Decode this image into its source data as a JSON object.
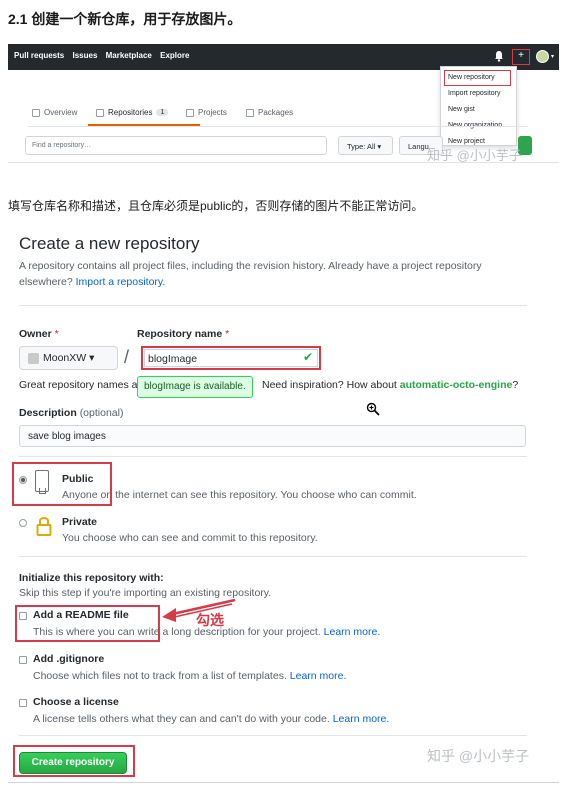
{
  "section_title": "2.1 创建一个新仓库，用于存放图片。",
  "instruction": "填写仓库名称和描述，且仓库必须是public的，否则存储的图片不能正常访问。",
  "header": {
    "nav": [
      "Pull requests",
      "Issues",
      "Marketplace",
      "Explore"
    ],
    "plus_label": "+",
    "caret": "▾"
  },
  "dropdown": {
    "items": [
      "New repository",
      "Import repository",
      "New gist",
      "New organization",
      "New project"
    ]
  },
  "tabs": {
    "overview": "Overview",
    "repositories": "Repositories",
    "repositories_count": "1",
    "projects": "Projects",
    "packages": "Packages"
  },
  "filters": {
    "find_placeholder": "Find a repository…",
    "type": "Type: All ▾",
    "language": "Langu..."
  },
  "watermark": "知乎 @小小芋子",
  "form": {
    "title": "Create a new repository",
    "subtitle": "A repository contains all project files, including the revision history. Already have a project repository elsewhere?",
    "import_link": "Import a repository.",
    "owner_label": "Owner",
    "owner_value": "MoonXW ▾",
    "repo_label": "Repository name",
    "required_mark": "*",
    "slash": "/",
    "repo_value": "blogImage",
    "great_text": "Great repository names a",
    "tooltip": "blogImage is available.",
    "inspiration_text": "Need inspiration? How about",
    "inspiration_name": "automatic-octo-engine",
    "inspiration_end": "?",
    "description_label": "Description",
    "description_optional": "(optional)",
    "description_value": "save blog images",
    "public_title": "Public",
    "public_desc": "Anyone on the internet can see this repository. You choose who can commit.",
    "private_title": "Private",
    "private_desc": "You choose who can see and commit to this repository.",
    "init_title": "Initialize this repository with:",
    "init_sub": "Skip this step if you're importing an existing repository.",
    "readme_title": "Add a README file",
    "readme_desc": "This is where you can write a long description for your project.",
    "gitignore_title": "Add .gitignore",
    "gitignore_desc": "Choose which files not to track from a list of templates.",
    "license_title": "Choose a license",
    "license_desc": "A license tells others what they can and can't do with your code.",
    "learn_more": "Learn more.",
    "annotation": "勾选",
    "create_button": "Create repository"
  },
  "colors": {
    "accent_red": "#d73a49",
    "github_dark": "#24292e",
    "green": "#28a745",
    "link_blue": "#0366d6"
  }
}
